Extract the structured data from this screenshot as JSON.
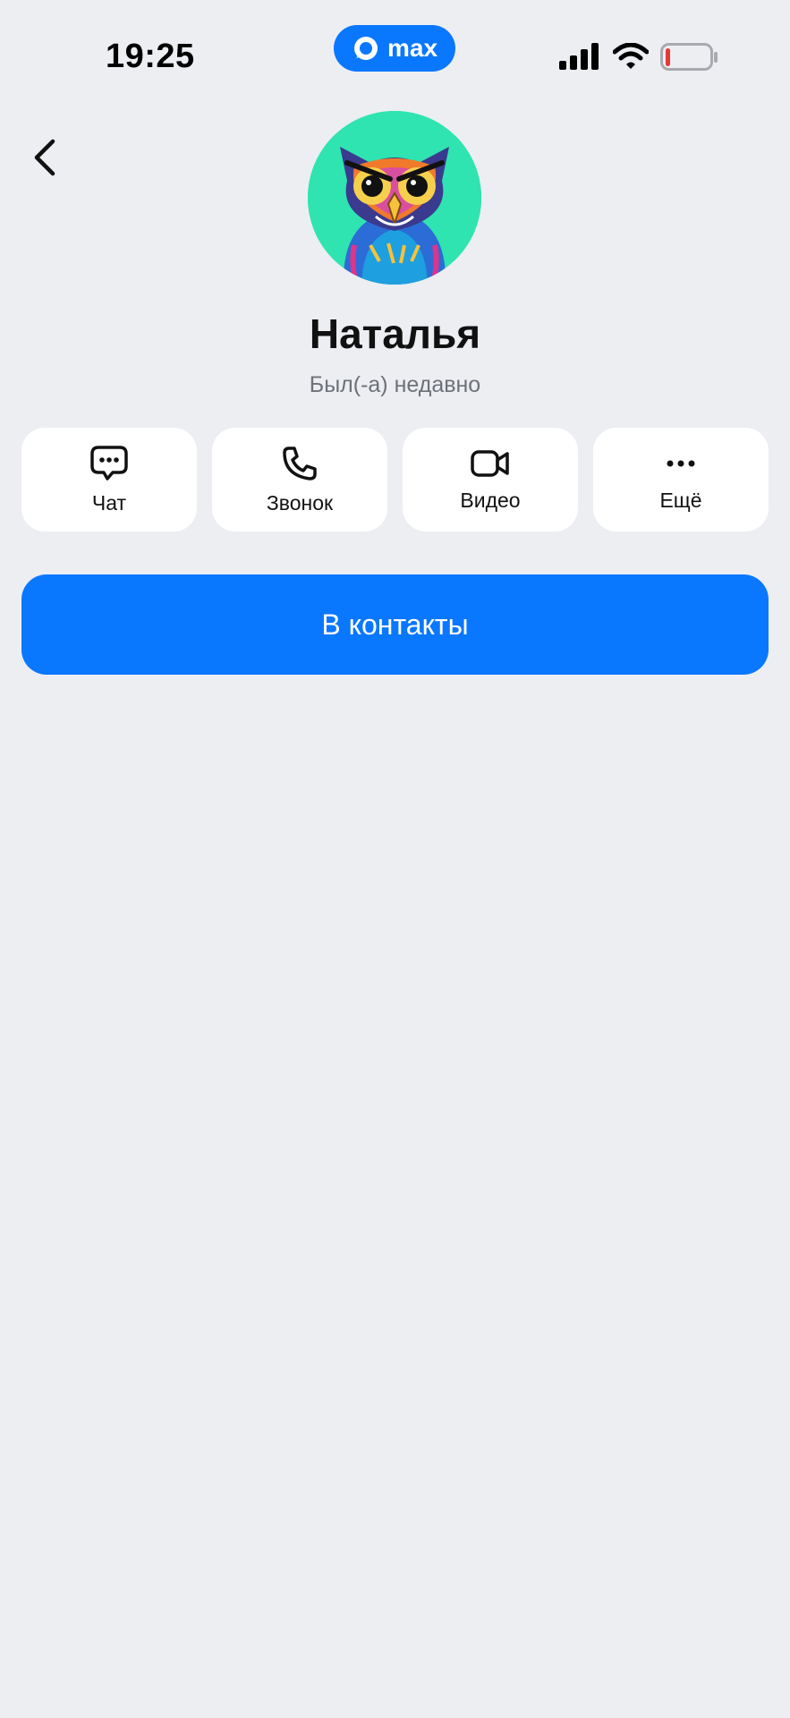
{
  "status_bar": {
    "time": "19:25",
    "app_badge": "max",
    "signal_icon": "cellular-signal-icon",
    "wifi_icon": "wifi-icon",
    "battery_icon": "battery-low-icon",
    "battery_level": 0.08,
    "battery_color": "#E53935"
  },
  "header": {
    "back_icon": "chevron-left-icon"
  },
  "profile": {
    "name": "Наталья",
    "status": "Был(-а) недавно",
    "avatar_icon": "owl-avatar",
    "avatar_bg": "#2FE4B0"
  },
  "actions": [
    {
      "label": "Чат",
      "icon": "chat-bubble-icon"
    },
    {
      "label": "Звонок",
      "icon": "phone-icon"
    },
    {
      "label": "Видео",
      "icon": "video-camera-icon"
    },
    {
      "label": "Ещё",
      "icon": "more-dots-icon"
    }
  ],
  "primary_button": {
    "label": "В контакты"
  },
  "colors": {
    "accent": "#0A77FF",
    "background": "#ECEEF2",
    "card": "#FFFFFF"
  }
}
